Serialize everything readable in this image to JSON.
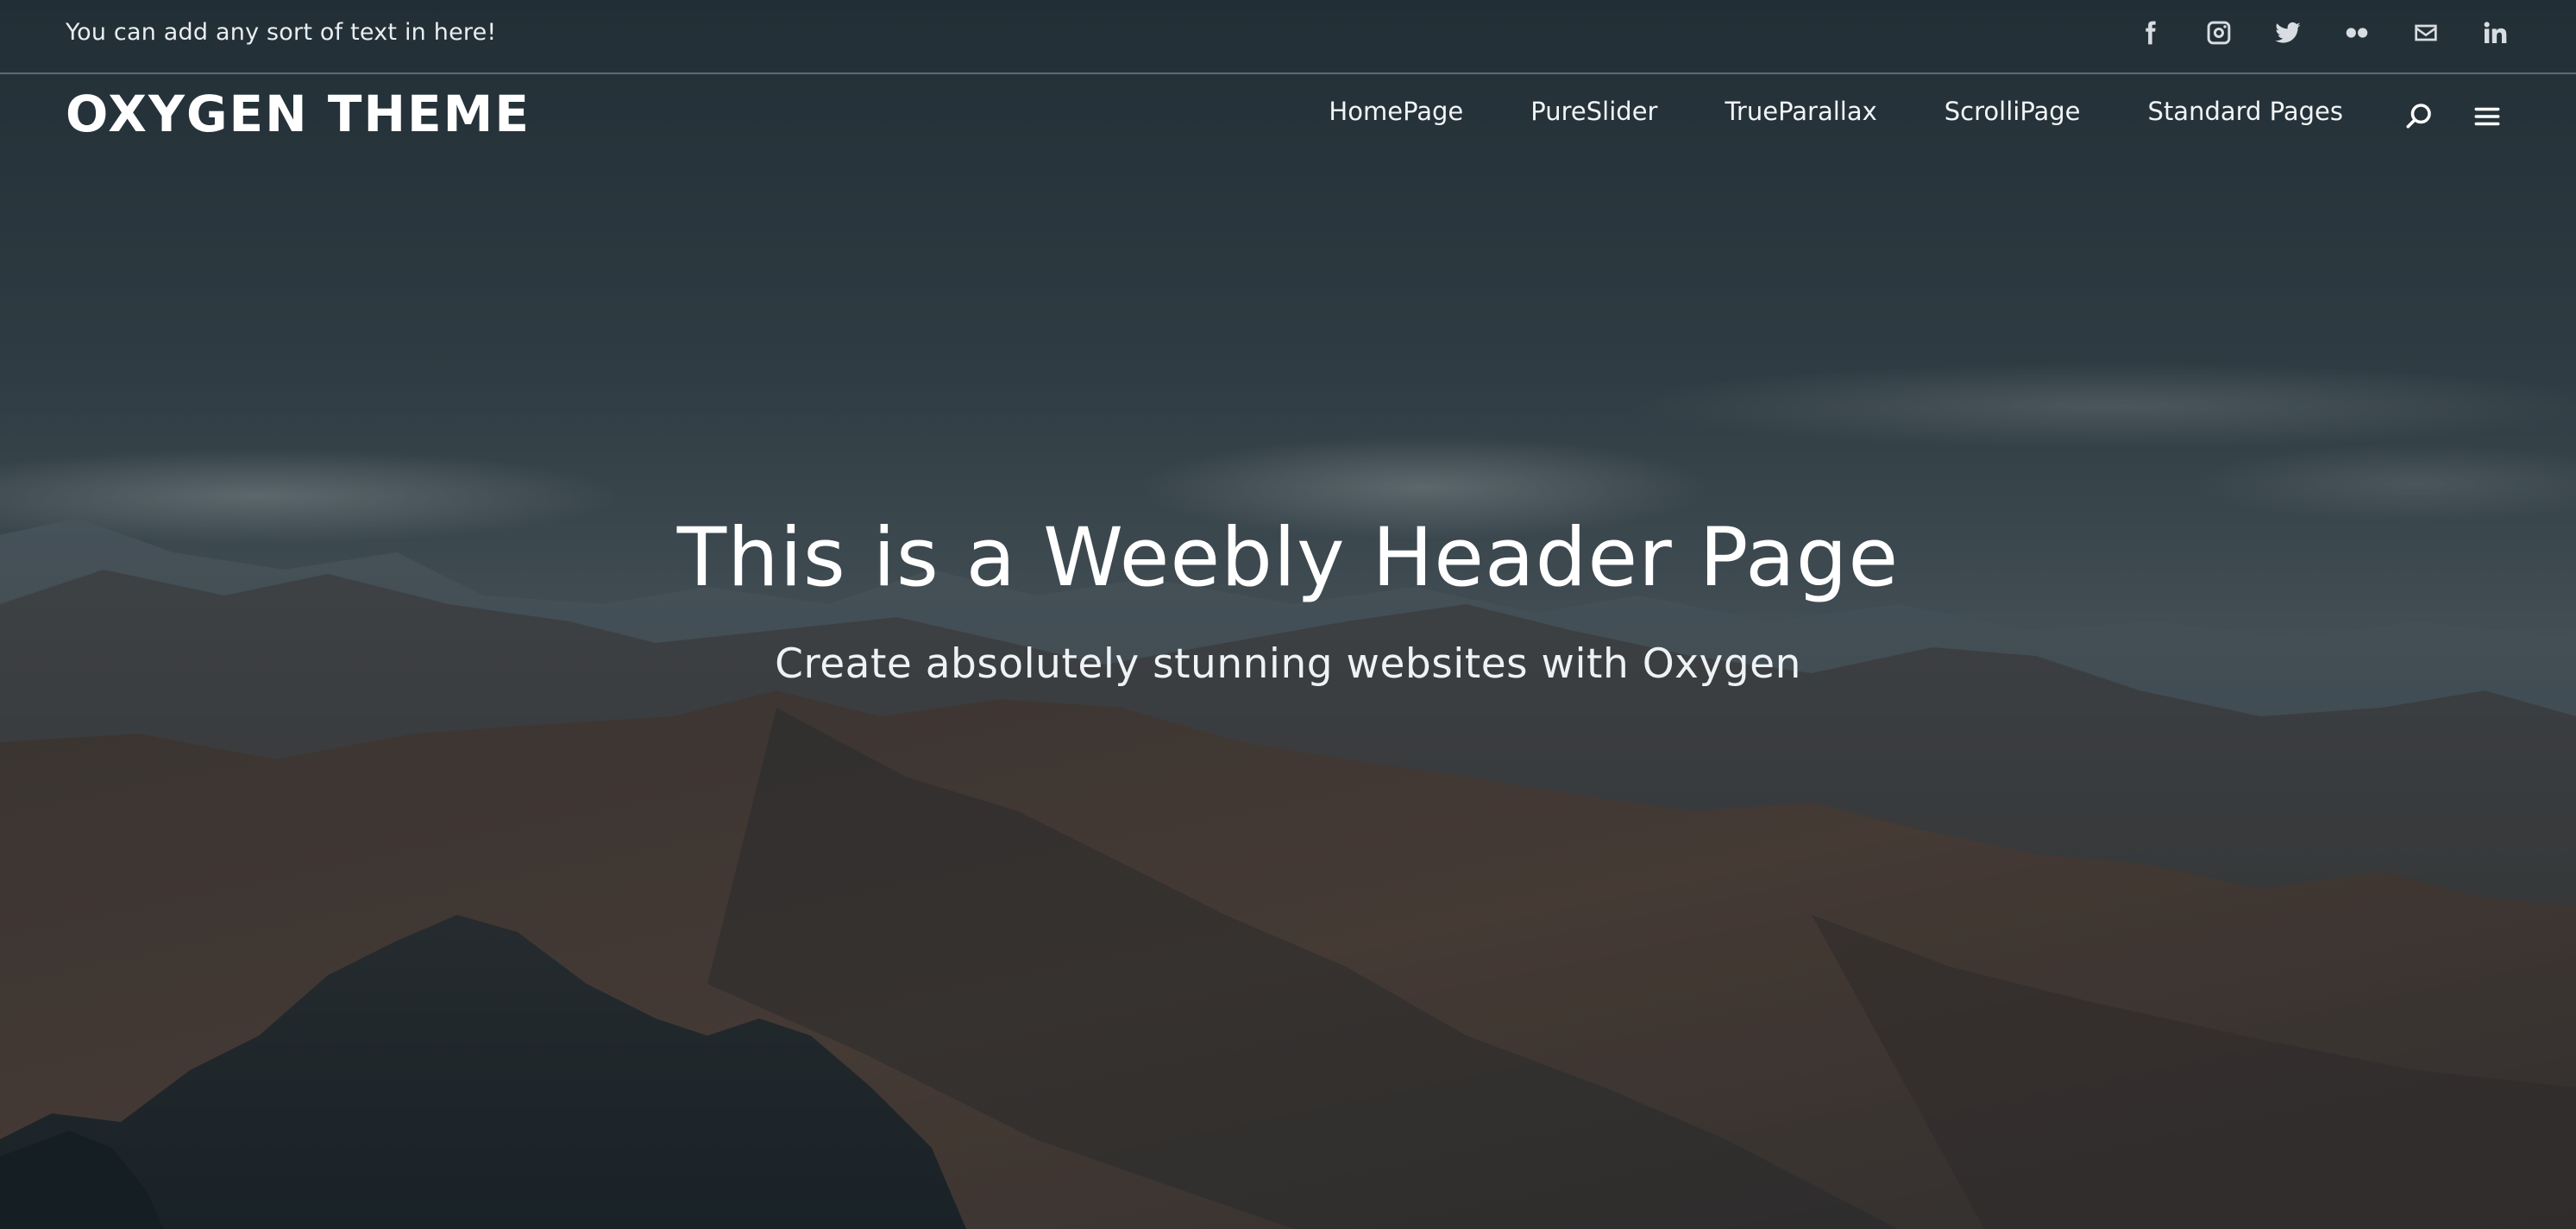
{
  "topbar": {
    "text": "You can add any sort of text in here!",
    "social": [
      {
        "icon": "facebook-icon"
      },
      {
        "icon": "instagram-icon"
      },
      {
        "icon": "twitter-icon"
      },
      {
        "icon": "flickr-icon"
      },
      {
        "icon": "mail-icon"
      },
      {
        "icon": "linkedin-icon"
      }
    ]
  },
  "header": {
    "logo": "OXYGEN THEME",
    "nav": [
      {
        "label": "HomePage"
      },
      {
        "label": "PureSlider"
      },
      {
        "label": "TrueParallax"
      },
      {
        "label": "ScrolliPage"
      },
      {
        "label": "Standard Pages"
      }
    ],
    "search_icon": "search-icon",
    "menu_icon": "hamburger-menu-icon"
  },
  "hero": {
    "title": "This is a Weebly Header Page",
    "subtitle": "Create absolutely stunning websites with Oxygen"
  },
  "colors": {
    "sky_top": "#2d3a42",
    "sky_mid": "#56656c",
    "mountain_dark": "#1e2a30",
    "mountain_warm": "#4a3a33",
    "text": "#ffffff"
  }
}
